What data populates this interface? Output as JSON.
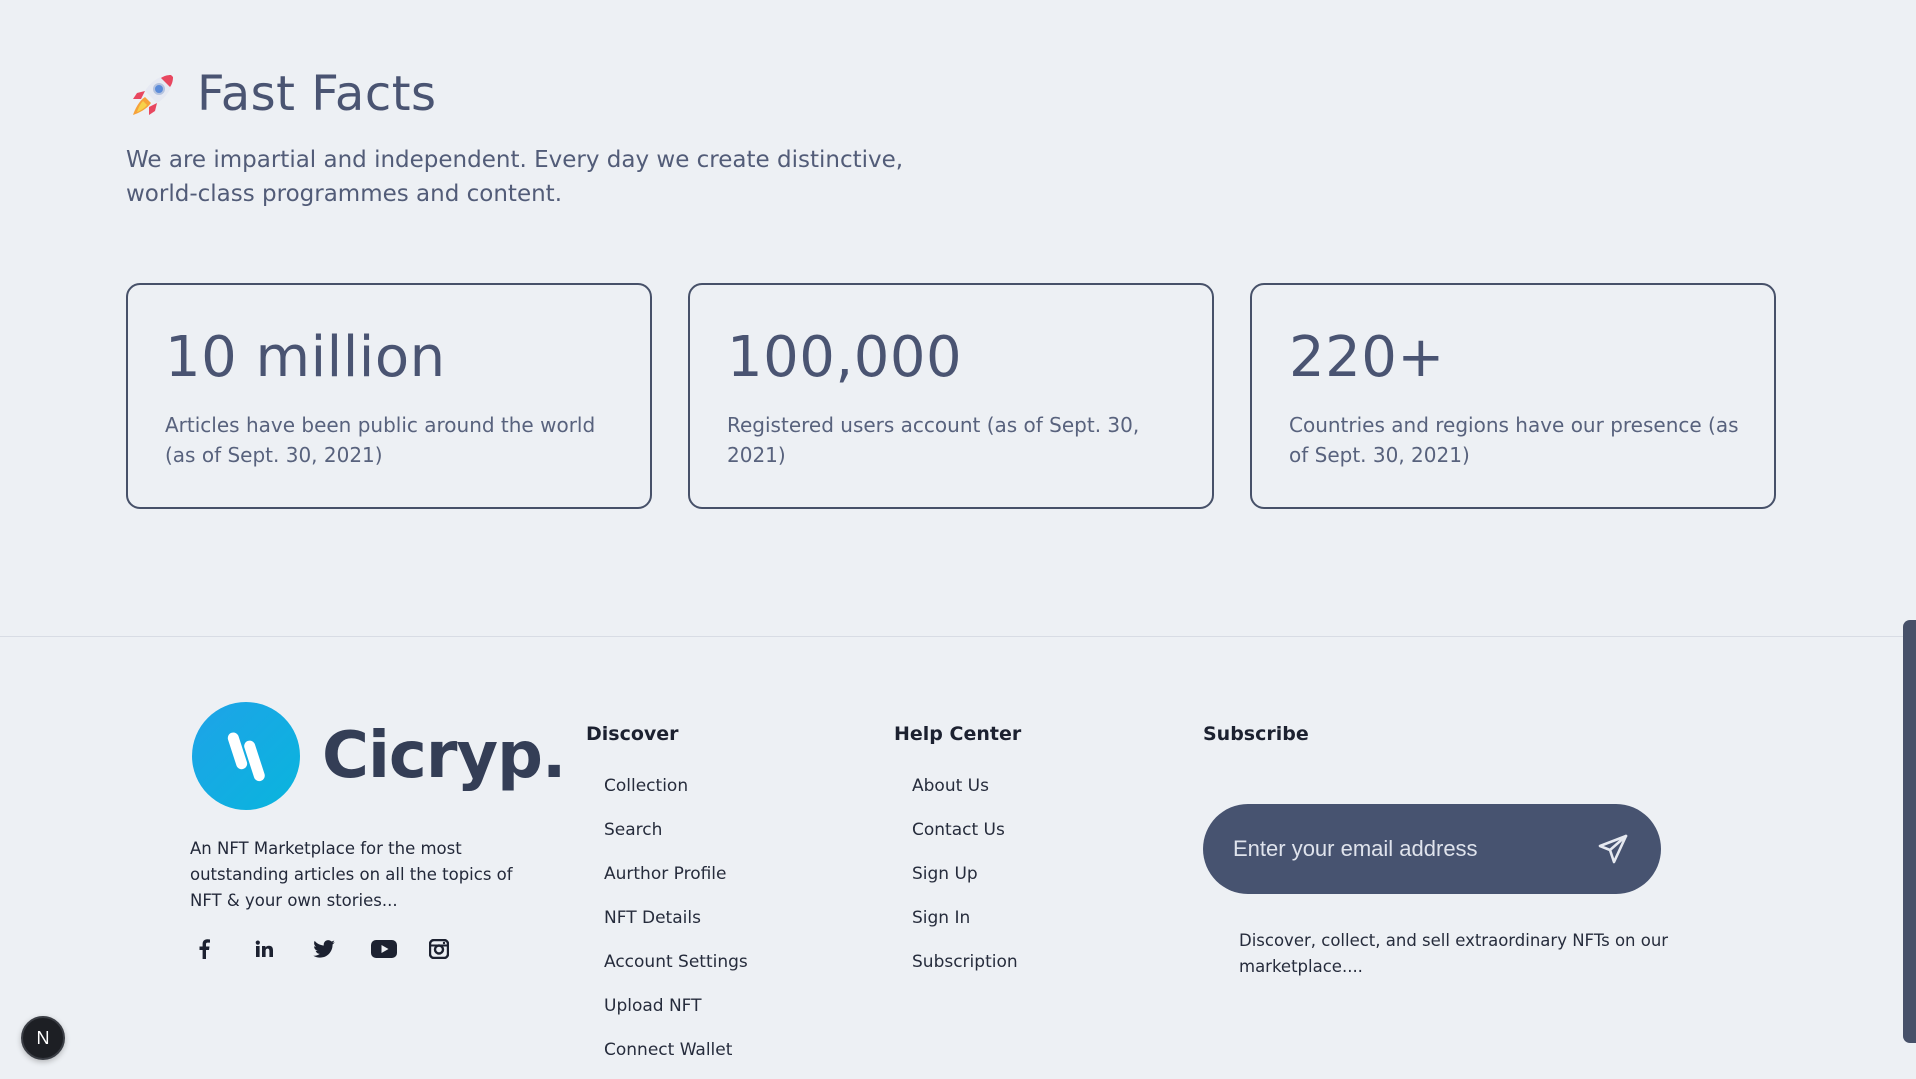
{
  "facts": {
    "title": "Fast Facts",
    "icon": "rocket-icon",
    "subtitle": "We are impartial and independent. Every day we create distinctive, world-class programmes and content.",
    "cards": [
      {
        "value": "10 million",
        "description": "Articles have been public around the world (as of Sept. 30, 2021)"
      },
      {
        "value": "100,000",
        "description": "Registered users account (as of Sept. 30, 2021)"
      },
      {
        "value": "220+",
        "description": "Countries and regions have our presence (as of Sept. 30, 2021)"
      }
    ]
  },
  "footer": {
    "brand": {
      "name": "Cicryp.",
      "description": "An NFT Marketplace for the most outstanding articles on all the topics of NFT & your own stories...",
      "social": [
        "facebook-icon",
        "linkedin-icon",
        "twitter-icon",
        "youtube-icon",
        "instagram-icon"
      ]
    },
    "discover": {
      "title": "Discover",
      "items": [
        "Collection",
        "Search",
        "Aurthor Profile",
        "NFT Details",
        "Account Settings",
        "Upload NFT",
        "Connect Wallet"
      ]
    },
    "help": {
      "title": "Help Center",
      "items": [
        "About Us",
        "Contact Us",
        "Sign Up",
        "Sign In",
        "Subscription"
      ]
    },
    "subscribe": {
      "title": "Subscribe",
      "placeholder": "Enter your email address",
      "description": "Discover, collect, and sell extraordinary NFTs on our marketplace...."
    }
  },
  "badge": {
    "label": "N"
  },
  "colors": {
    "background": "#edf0f4",
    "text": "#4a5472",
    "card_border": "#475169",
    "subscribe_bg": "#475370",
    "logo_gradient_start": "#1ea3e8",
    "logo_gradient_end": "#09b5dd"
  }
}
